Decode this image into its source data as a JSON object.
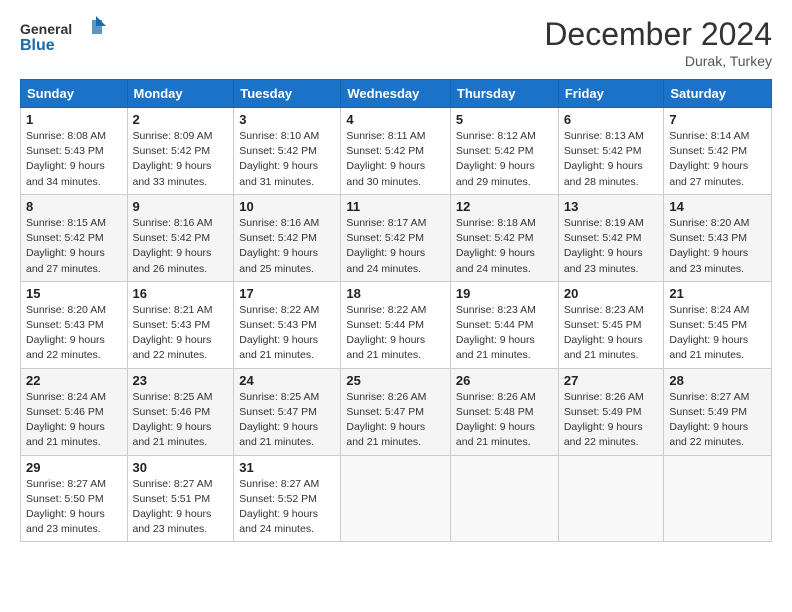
{
  "header": {
    "logo_line1": "General",
    "logo_line2": "Blue",
    "month_title": "December 2024",
    "subtitle": "Durak, Turkey"
  },
  "days_of_week": [
    "Sunday",
    "Monday",
    "Tuesday",
    "Wednesday",
    "Thursday",
    "Friday",
    "Saturday"
  ],
  "weeks": [
    [
      {
        "day": 1,
        "info": "Sunrise: 8:08 AM\nSunset: 5:43 PM\nDaylight: 9 hours\nand 34 minutes."
      },
      {
        "day": 2,
        "info": "Sunrise: 8:09 AM\nSunset: 5:42 PM\nDaylight: 9 hours\nand 33 minutes."
      },
      {
        "day": 3,
        "info": "Sunrise: 8:10 AM\nSunset: 5:42 PM\nDaylight: 9 hours\nand 31 minutes."
      },
      {
        "day": 4,
        "info": "Sunrise: 8:11 AM\nSunset: 5:42 PM\nDaylight: 9 hours\nand 30 minutes."
      },
      {
        "day": 5,
        "info": "Sunrise: 8:12 AM\nSunset: 5:42 PM\nDaylight: 9 hours\nand 29 minutes."
      },
      {
        "day": 6,
        "info": "Sunrise: 8:13 AM\nSunset: 5:42 PM\nDaylight: 9 hours\nand 28 minutes."
      },
      {
        "day": 7,
        "info": "Sunrise: 8:14 AM\nSunset: 5:42 PM\nDaylight: 9 hours\nand 27 minutes."
      }
    ],
    [
      {
        "day": 8,
        "info": "Sunrise: 8:15 AM\nSunset: 5:42 PM\nDaylight: 9 hours\nand 27 minutes."
      },
      {
        "day": 9,
        "info": "Sunrise: 8:16 AM\nSunset: 5:42 PM\nDaylight: 9 hours\nand 26 minutes."
      },
      {
        "day": 10,
        "info": "Sunrise: 8:16 AM\nSunset: 5:42 PM\nDaylight: 9 hours\nand 25 minutes."
      },
      {
        "day": 11,
        "info": "Sunrise: 8:17 AM\nSunset: 5:42 PM\nDaylight: 9 hours\nand 24 minutes."
      },
      {
        "day": 12,
        "info": "Sunrise: 8:18 AM\nSunset: 5:42 PM\nDaylight: 9 hours\nand 24 minutes."
      },
      {
        "day": 13,
        "info": "Sunrise: 8:19 AM\nSunset: 5:42 PM\nDaylight: 9 hours\nand 23 minutes."
      },
      {
        "day": 14,
        "info": "Sunrise: 8:20 AM\nSunset: 5:43 PM\nDaylight: 9 hours\nand 23 minutes."
      }
    ],
    [
      {
        "day": 15,
        "info": "Sunrise: 8:20 AM\nSunset: 5:43 PM\nDaylight: 9 hours\nand 22 minutes."
      },
      {
        "day": 16,
        "info": "Sunrise: 8:21 AM\nSunset: 5:43 PM\nDaylight: 9 hours\nand 22 minutes."
      },
      {
        "day": 17,
        "info": "Sunrise: 8:22 AM\nSunset: 5:43 PM\nDaylight: 9 hours\nand 21 minutes."
      },
      {
        "day": 18,
        "info": "Sunrise: 8:22 AM\nSunset: 5:44 PM\nDaylight: 9 hours\nand 21 minutes."
      },
      {
        "day": 19,
        "info": "Sunrise: 8:23 AM\nSunset: 5:44 PM\nDaylight: 9 hours\nand 21 minutes."
      },
      {
        "day": 20,
        "info": "Sunrise: 8:23 AM\nSunset: 5:45 PM\nDaylight: 9 hours\nand 21 minutes."
      },
      {
        "day": 21,
        "info": "Sunrise: 8:24 AM\nSunset: 5:45 PM\nDaylight: 9 hours\nand 21 minutes."
      }
    ],
    [
      {
        "day": 22,
        "info": "Sunrise: 8:24 AM\nSunset: 5:46 PM\nDaylight: 9 hours\nand 21 minutes."
      },
      {
        "day": 23,
        "info": "Sunrise: 8:25 AM\nSunset: 5:46 PM\nDaylight: 9 hours\nand 21 minutes."
      },
      {
        "day": 24,
        "info": "Sunrise: 8:25 AM\nSunset: 5:47 PM\nDaylight: 9 hours\nand 21 minutes."
      },
      {
        "day": 25,
        "info": "Sunrise: 8:26 AM\nSunset: 5:47 PM\nDaylight: 9 hours\nand 21 minutes."
      },
      {
        "day": 26,
        "info": "Sunrise: 8:26 AM\nSunset: 5:48 PM\nDaylight: 9 hours\nand 21 minutes."
      },
      {
        "day": 27,
        "info": "Sunrise: 8:26 AM\nSunset: 5:49 PM\nDaylight: 9 hours\nand 22 minutes."
      },
      {
        "day": 28,
        "info": "Sunrise: 8:27 AM\nSunset: 5:49 PM\nDaylight: 9 hours\nand 22 minutes."
      }
    ],
    [
      {
        "day": 29,
        "info": "Sunrise: 8:27 AM\nSunset: 5:50 PM\nDaylight: 9 hours\nand 23 minutes."
      },
      {
        "day": 30,
        "info": "Sunrise: 8:27 AM\nSunset: 5:51 PM\nDaylight: 9 hours\nand 23 minutes."
      },
      {
        "day": 31,
        "info": "Sunrise: 8:27 AM\nSunset: 5:52 PM\nDaylight: 9 hours\nand 24 minutes."
      },
      null,
      null,
      null,
      null
    ]
  ]
}
